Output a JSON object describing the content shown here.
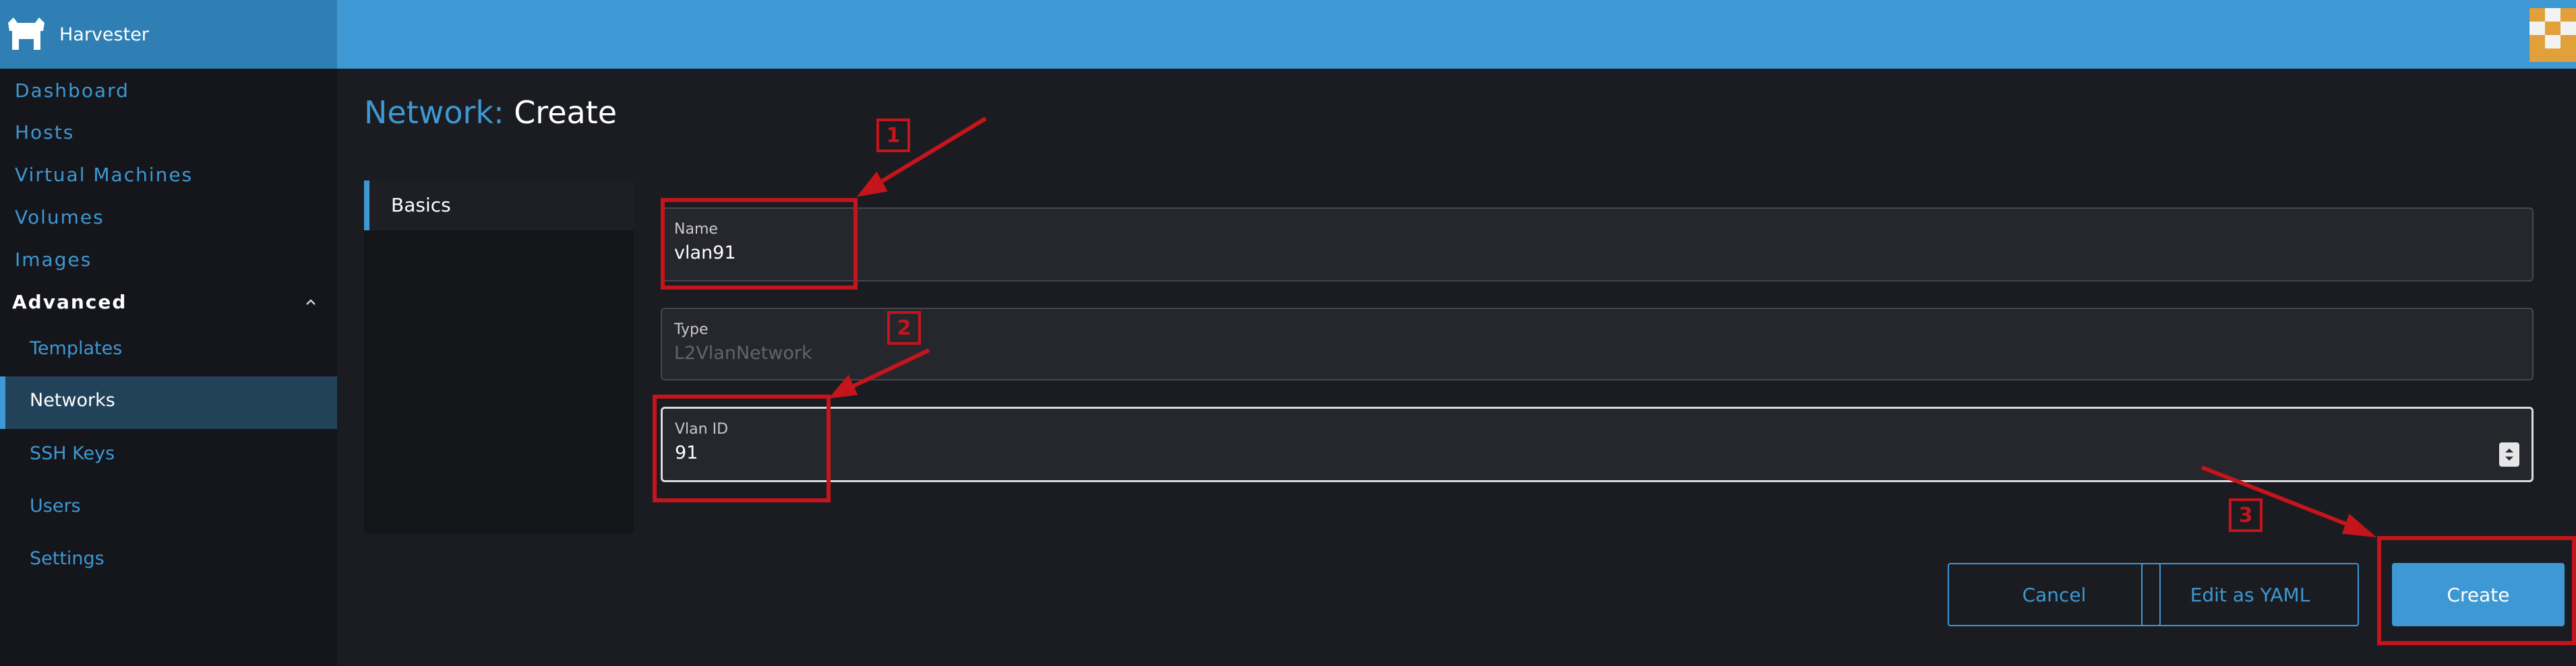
{
  "app": {
    "name": "Harvester"
  },
  "sidebar": {
    "items": [
      {
        "label": "Dashboard"
      },
      {
        "label": "Hosts"
      },
      {
        "label": "Virtual Machines"
      },
      {
        "label": "Volumes"
      },
      {
        "label": "Images"
      }
    ],
    "group": {
      "label": "Advanced",
      "items": [
        {
          "label": "Templates"
        },
        {
          "label": "Networks",
          "active": true
        },
        {
          "label": "SSH Keys"
        },
        {
          "label": "Users"
        },
        {
          "label": "Settings"
        }
      ]
    }
  },
  "page": {
    "resource": "Network:",
    "action": "Create"
  },
  "tabs": [
    {
      "label": "Basics"
    }
  ],
  "form": {
    "name": {
      "label": "Name",
      "value": "vlan91"
    },
    "type": {
      "label": "Type",
      "value": "L2VlanNetwork"
    },
    "vlan": {
      "label": "Vlan ID",
      "value": "91"
    }
  },
  "buttons": {
    "cancel": "Cancel",
    "yaml": "Edit as YAML",
    "create": "Create"
  },
  "annotations": {
    "n1": "1",
    "n2": "2",
    "n3": "3"
  },
  "colors": {
    "accent": "#3d98d3",
    "annotation": "#c4151c",
    "background": "#1b1c21"
  }
}
